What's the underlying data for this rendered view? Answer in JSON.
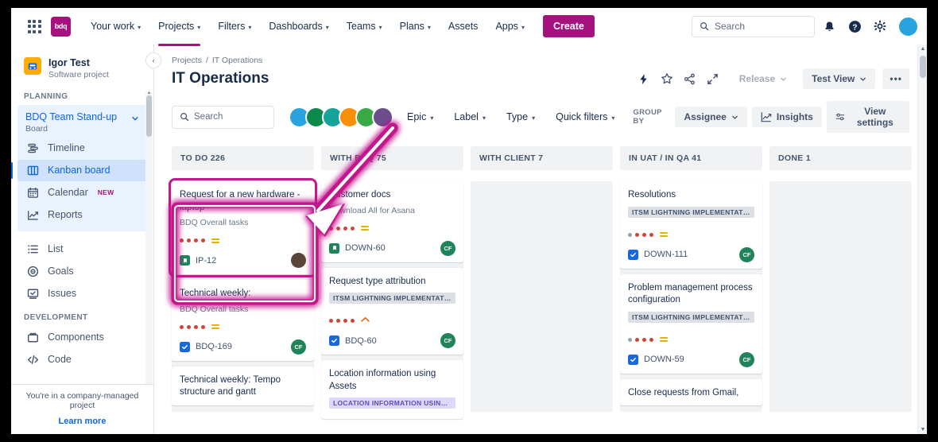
{
  "topnav": {
    "app_switcher": "app-switcher",
    "brand": "bdq",
    "items": [
      {
        "label": "Your work",
        "caret": true,
        "active": false
      },
      {
        "label": "Projects",
        "caret": true,
        "active": true
      },
      {
        "label": "Filters",
        "caret": true,
        "active": false
      },
      {
        "label": "Dashboards",
        "caret": true,
        "active": false
      },
      {
        "label": "Teams",
        "caret": true,
        "active": false
      },
      {
        "label": "Plans",
        "caret": true,
        "active": false
      },
      {
        "label": "Assets",
        "caret": false,
        "active": false
      },
      {
        "label": "Apps",
        "caret": true,
        "active": false
      }
    ],
    "create_label": "Create",
    "search_placeholder": "Search",
    "icons": [
      "notifications-icon",
      "help-icon",
      "settings-icon"
    ],
    "avatar_color": "#2AA3DE",
    "brand_color": "#A5127E"
  },
  "sidebar": {
    "project_name": "Igor Test",
    "project_type": "Software project",
    "collapse_label": "‹",
    "planning_label": "PLANNING",
    "board_name": "BDQ Team Stand-up",
    "board_sub": "Board",
    "planning_items": [
      {
        "label": "Timeline",
        "icon": "timeline-icon",
        "selected": false,
        "badge": ""
      },
      {
        "label": "Kanban board",
        "icon": "board-icon",
        "selected": true,
        "badge": ""
      },
      {
        "label": "Calendar",
        "icon": "calendar-icon",
        "selected": false,
        "badge": "NEW"
      },
      {
        "label": "Reports",
        "icon": "reports-icon",
        "selected": false,
        "badge": ""
      }
    ],
    "other_items": [
      {
        "label": "List",
        "icon": "list-icon"
      },
      {
        "label": "Goals",
        "icon": "goals-icon"
      },
      {
        "label": "Issues",
        "icon": "issues-icon"
      }
    ],
    "development_label": "DEVELOPMENT",
    "dev_items": [
      {
        "label": "Components",
        "icon": "components-icon"
      },
      {
        "label": "Code",
        "icon": "code-icon"
      }
    ],
    "footer_note": "You're in a company-managed project",
    "footer_link": "Learn more"
  },
  "header": {
    "breadcrumb_root": "Projects",
    "breadcrumb_sep": "/",
    "breadcrumb_current": "IT Operations",
    "title": "IT Operations",
    "action_icons": [
      "lightning-icon",
      "star-icon",
      "share-icon",
      "expand-icon"
    ],
    "release_label": "Release",
    "view_label": "Test View",
    "more_label": "•••"
  },
  "toolbar": {
    "search_placeholder": "Search",
    "avatars": [
      "#2AA3DE",
      "#0C8A4B",
      "#15A39A",
      "#F79009",
      "#39A845",
      "#6B4D8C"
    ],
    "filters": [
      {
        "label": "Epic",
        "caret": true
      },
      {
        "label": "Label",
        "caret": true
      },
      {
        "label": "Type",
        "caret": true
      },
      {
        "label": "Quick filters",
        "caret": true
      }
    ],
    "group_by_label": "GROUP BY",
    "group_by_value": "Assignee",
    "insights_label": "Insights",
    "view_settings_label": "View settings"
  },
  "board": {
    "columns": [
      {
        "title": "TO DO 226",
        "cards": [
          {
            "title": "Request for a new hardware - laptop",
            "subtitle": "BDQ Overall tasks",
            "epic": "",
            "epic_style": "",
            "dots": [
              "#D04437",
              "#D04437",
              "#D04437",
              "#D04437"
            ],
            "priority": "medium",
            "type": "story",
            "key": "IP-12",
            "avatar_initials": "",
            "avatar_color": "#5B4438",
            "highlighted": true
          },
          {
            "title": "Technical weekly:",
            "subtitle": "BDQ Overall tasks",
            "epic": "",
            "epic_style": "",
            "dots": [
              "#D04437",
              "#D04437",
              "#D04437",
              "#D04437"
            ],
            "priority": "medium",
            "type": "task",
            "key": "BDQ-169",
            "avatar_initials": "CF",
            "avatar_color": "#1F845A",
            "highlighted": false
          },
          {
            "title": "Technical weekly: Tempo structure and gantt",
            "subtitle": "",
            "epic": "",
            "epic_style": "",
            "dots": [],
            "priority": "",
            "type": "",
            "key": "",
            "avatar_initials": "",
            "avatar_color": "",
            "highlighted": false
          }
        ]
      },
      {
        "title": "WITH BDQ 75",
        "cards": [
          {
            "title": "Customer docs",
            "subtitle": "Download All for Asana",
            "epic": "",
            "epic_style": "",
            "dots": [
              "#D04437",
              "#D04437",
              "#D04437",
              "#D04437"
            ],
            "priority": "medium",
            "type": "story",
            "key": "DOWN-60",
            "avatar_initials": "CF",
            "avatar_color": "#1F845A",
            "highlighted": false
          },
          {
            "title": "Request type attribution",
            "subtitle": "",
            "epic": "ITSM LIGHTNING IMPLEMENTATION",
            "epic_style": "grey",
            "dots": [
              "#D04437",
              "#D04437",
              "#D04437",
              "#D04437"
            ],
            "priority": "high",
            "type": "task",
            "key": "BDQ-60",
            "avatar_initials": "CF",
            "avatar_color": "#1F845A",
            "highlighted": false
          },
          {
            "title": "Location information using Assets",
            "subtitle": "",
            "epic": "LOCATION INFORMATION USING A...",
            "epic_style": "purple",
            "dots": [],
            "priority": "",
            "type": "",
            "key": "",
            "avatar_initials": "",
            "avatar_color": "",
            "highlighted": false
          }
        ]
      },
      {
        "title": "WITH CLIENT 7",
        "cards": []
      },
      {
        "title": "IN UAT / IN QA 41",
        "cards": [
          {
            "title": "Resolutions",
            "subtitle": "",
            "epic": "ITSM LIGHTNING IMPLEMENTATION",
            "epic_style": "grey",
            "dots": [
              "#97A0AF",
              "#D04437",
              "#D04437",
              "#D04437"
            ],
            "priority": "medium",
            "type": "task",
            "key": "DOWN-111",
            "avatar_initials": "CF",
            "avatar_color": "#1F845A",
            "highlighted": false
          },
          {
            "title": "Problem management process configuration",
            "subtitle": "",
            "epic": "ITSM LIGHTNING IMPLEMENTATION",
            "epic_style": "grey",
            "dots": [
              "#97A0AF",
              "#D04437",
              "#D04437",
              "#D04437"
            ],
            "priority": "medium",
            "type": "task",
            "key": "DOWN-59",
            "avatar_initials": "CF",
            "avatar_color": "#1F845A",
            "highlighted": false
          },
          {
            "title": "Close requests from Gmail,",
            "subtitle": "",
            "epic": "",
            "epic_style": "",
            "dots": [],
            "priority": "",
            "type": "",
            "key": "",
            "avatar_initials": "",
            "avatar_color": "",
            "highlighted": false
          }
        ]
      },
      {
        "title": "DONE 1",
        "cards": []
      }
    ]
  },
  "annotation": {
    "type": "arrow",
    "color": "#C2198B",
    "points_from": "avatar-group",
    "points_to": "highlighted-card"
  }
}
